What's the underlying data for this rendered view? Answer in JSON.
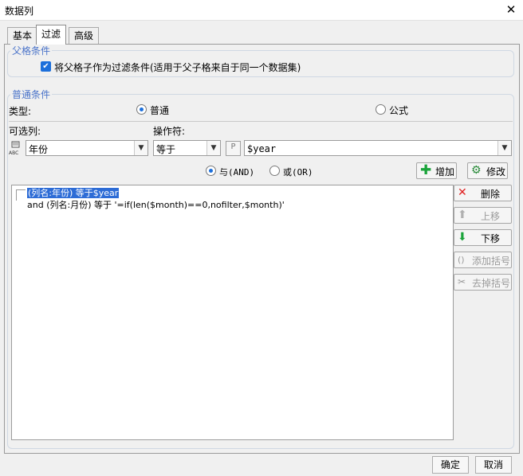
{
  "window": {
    "title": "数据列",
    "close_glyph": "✕"
  },
  "tabs": [
    {
      "label": "基本",
      "active": false
    },
    {
      "label": "过滤",
      "active": true
    },
    {
      "label": "高级",
      "active": false
    }
  ],
  "parent_section": {
    "legend": "父格条件",
    "checkbox_label": "将父格子作为过滤条件(适用于父子格来自于同一个数据集)",
    "checked": true
  },
  "normal_section": {
    "legend": "普通条件",
    "type_label": "类型:",
    "type_options": [
      {
        "label": "普通",
        "selected": true
      },
      {
        "label": "公式",
        "selected": false
      }
    ],
    "column_label": "可选列:",
    "operator_label": "操作符:",
    "column_value": "年份",
    "operator_value": "等于",
    "param_badge": "P",
    "value_text": "$year",
    "logic_options": [
      {
        "label": "与(AND)",
        "selected": true
      },
      {
        "label": "或(OR)",
        "selected": false
      }
    ],
    "add_button": "增加",
    "modify_button": "修改"
  },
  "conditions": [
    {
      "prefix": "",
      "text": "(列名:年份) 等于$year",
      "selected": true
    },
    {
      "prefix": "and ",
      "text": "(列名:月份) 等于 '=if(len($month)==0,nofilter,$month)'",
      "selected": false
    }
  ],
  "side_buttons": [
    {
      "label": "删除",
      "icon": "delete-icon",
      "glyph": "✕",
      "color": "#e02020",
      "enabled": true
    },
    {
      "label": "上移",
      "icon": "arrow-up-icon",
      "glyph": "⬆",
      "color": "#9a9a9a",
      "enabled": false
    },
    {
      "label": "下移",
      "icon": "arrow-down-icon",
      "glyph": "⬇",
      "color": "#1aa33a",
      "enabled": true
    },
    {
      "label": "添加括号",
      "icon": "add-bracket-icon",
      "glyph": "()",
      "color": "#9a9a9a",
      "enabled": false
    },
    {
      "label": "去掉括号",
      "icon": "remove-bracket-icon",
      "glyph": "✂",
      "color": "#9a9a9a",
      "enabled": false
    }
  ],
  "footer": {
    "ok": "确定",
    "cancel": "取消"
  }
}
